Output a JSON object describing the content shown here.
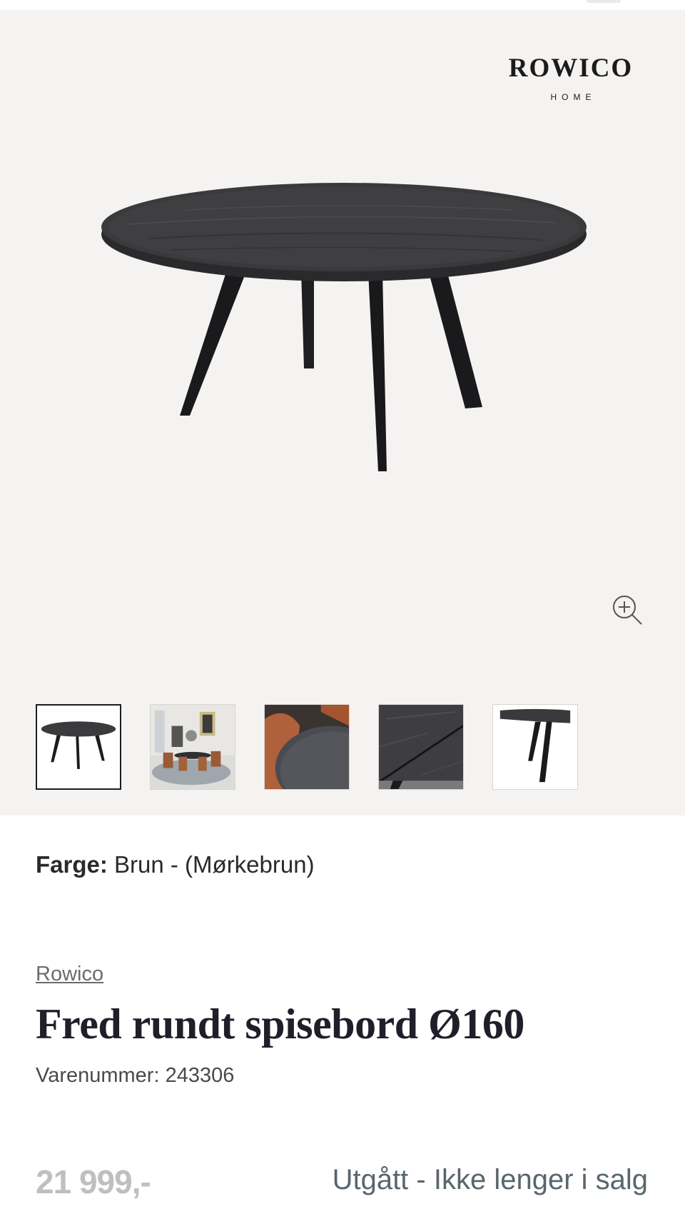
{
  "brand": {
    "name": "ROWICO",
    "sub": "HOME"
  },
  "gallery": {
    "main_image": "round-dining-table-dark-oak",
    "zoom_icon": "zoom-in-icon",
    "thumbnails": [
      {
        "name": "thumb-table-front",
        "active": true
      },
      {
        "name": "thumb-dining-room",
        "active": false
      },
      {
        "name": "thumb-tabletop-edge-chair",
        "active": false
      },
      {
        "name": "thumb-wood-grain-detail",
        "active": false
      },
      {
        "name": "thumb-table-leg-detail",
        "active": false
      }
    ]
  },
  "variant": {
    "label": "Farge:",
    "value": " Brun - (Mørkebrun)"
  },
  "product": {
    "brand_link": "Rowico",
    "title": "Fred rundt spisebord Ø160",
    "sku_label": "Varenummer: ",
    "sku": "243306",
    "price": "21 999,-",
    "status": "Utgått - Ikke lenger i salg"
  },
  "colors": {
    "gallery_bg": "#f5f3f1",
    "price": "#bfbfbf",
    "status": "#59666b",
    "title": "#1f1f2a"
  }
}
